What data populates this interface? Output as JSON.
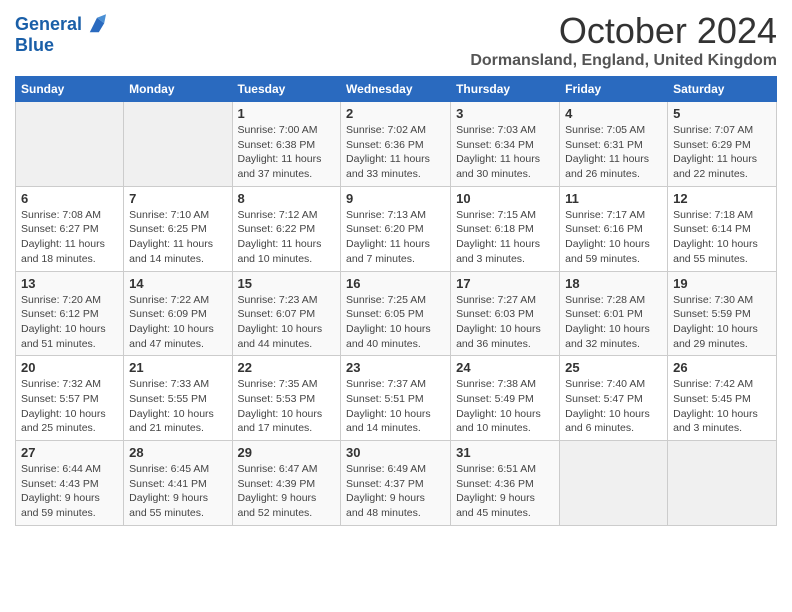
{
  "header": {
    "logo_line1": "General",
    "logo_line2": "Blue",
    "month": "October 2024",
    "location": "Dormansland, England, United Kingdom"
  },
  "weekdays": [
    "Sunday",
    "Monday",
    "Tuesday",
    "Wednesday",
    "Thursday",
    "Friday",
    "Saturday"
  ],
  "weeks": [
    [
      {
        "day": "",
        "info": ""
      },
      {
        "day": "",
        "info": ""
      },
      {
        "day": "1",
        "info": "Sunrise: 7:00 AM\nSunset: 6:38 PM\nDaylight: 11 hours and 37 minutes."
      },
      {
        "day": "2",
        "info": "Sunrise: 7:02 AM\nSunset: 6:36 PM\nDaylight: 11 hours and 33 minutes."
      },
      {
        "day": "3",
        "info": "Sunrise: 7:03 AM\nSunset: 6:34 PM\nDaylight: 11 hours and 30 minutes."
      },
      {
        "day": "4",
        "info": "Sunrise: 7:05 AM\nSunset: 6:31 PM\nDaylight: 11 hours and 26 minutes."
      },
      {
        "day": "5",
        "info": "Sunrise: 7:07 AM\nSunset: 6:29 PM\nDaylight: 11 hours and 22 minutes."
      }
    ],
    [
      {
        "day": "6",
        "info": "Sunrise: 7:08 AM\nSunset: 6:27 PM\nDaylight: 11 hours and 18 minutes."
      },
      {
        "day": "7",
        "info": "Sunrise: 7:10 AM\nSunset: 6:25 PM\nDaylight: 11 hours and 14 minutes."
      },
      {
        "day": "8",
        "info": "Sunrise: 7:12 AM\nSunset: 6:22 PM\nDaylight: 11 hours and 10 minutes."
      },
      {
        "day": "9",
        "info": "Sunrise: 7:13 AM\nSunset: 6:20 PM\nDaylight: 11 hours and 7 minutes."
      },
      {
        "day": "10",
        "info": "Sunrise: 7:15 AM\nSunset: 6:18 PM\nDaylight: 11 hours and 3 minutes."
      },
      {
        "day": "11",
        "info": "Sunrise: 7:17 AM\nSunset: 6:16 PM\nDaylight: 10 hours and 59 minutes."
      },
      {
        "day": "12",
        "info": "Sunrise: 7:18 AM\nSunset: 6:14 PM\nDaylight: 10 hours and 55 minutes."
      }
    ],
    [
      {
        "day": "13",
        "info": "Sunrise: 7:20 AM\nSunset: 6:12 PM\nDaylight: 10 hours and 51 minutes."
      },
      {
        "day": "14",
        "info": "Sunrise: 7:22 AM\nSunset: 6:09 PM\nDaylight: 10 hours and 47 minutes."
      },
      {
        "day": "15",
        "info": "Sunrise: 7:23 AM\nSunset: 6:07 PM\nDaylight: 10 hours and 44 minutes."
      },
      {
        "day": "16",
        "info": "Sunrise: 7:25 AM\nSunset: 6:05 PM\nDaylight: 10 hours and 40 minutes."
      },
      {
        "day": "17",
        "info": "Sunrise: 7:27 AM\nSunset: 6:03 PM\nDaylight: 10 hours and 36 minutes."
      },
      {
        "day": "18",
        "info": "Sunrise: 7:28 AM\nSunset: 6:01 PM\nDaylight: 10 hours and 32 minutes."
      },
      {
        "day": "19",
        "info": "Sunrise: 7:30 AM\nSunset: 5:59 PM\nDaylight: 10 hours and 29 minutes."
      }
    ],
    [
      {
        "day": "20",
        "info": "Sunrise: 7:32 AM\nSunset: 5:57 PM\nDaylight: 10 hours and 25 minutes."
      },
      {
        "day": "21",
        "info": "Sunrise: 7:33 AM\nSunset: 5:55 PM\nDaylight: 10 hours and 21 minutes."
      },
      {
        "day": "22",
        "info": "Sunrise: 7:35 AM\nSunset: 5:53 PM\nDaylight: 10 hours and 17 minutes."
      },
      {
        "day": "23",
        "info": "Sunrise: 7:37 AM\nSunset: 5:51 PM\nDaylight: 10 hours and 14 minutes."
      },
      {
        "day": "24",
        "info": "Sunrise: 7:38 AM\nSunset: 5:49 PM\nDaylight: 10 hours and 10 minutes."
      },
      {
        "day": "25",
        "info": "Sunrise: 7:40 AM\nSunset: 5:47 PM\nDaylight: 10 hours and 6 minutes."
      },
      {
        "day": "26",
        "info": "Sunrise: 7:42 AM\nSunset: 5:45 PM\nDaylight: 10 hours and 3 minutes."
      }
    ],
    [
      {
        "day": "27",
        "info": "Sunrise: 6:44 AM\nSunset: 4:43 PM\nDaylight: 9 hours and 59 minutes."
      },
      {
        "day": "28",
        "info": "Sunrise: 6:45 AM\nSunset: 4:41 PM\nDaylight: 9 hours and 55 minutes."
      },
      {
        "day": "29",
        "info": "Sunrise: 6:47 AM\nSunset: 4:39 PM\nDaylight: 9 hours and 52 minutes."
      },
      {
        "day": "30",
        "info": "Sunrise: 6:49 AM\nSunset: 4:37 PM\nDaylight: 9 hours and 48 minutes."
      },
      {
        "day": "31",
        "info": "Sunrise: 6:51 AM\nSunset: 4:36 PM\nDaylight: 9 hours and 45 minutes."
      },
      {
        "day": "",
        "info": ""
      },
      {
        "day": "",
        "info": ""
      }
    ]
  ]
}
